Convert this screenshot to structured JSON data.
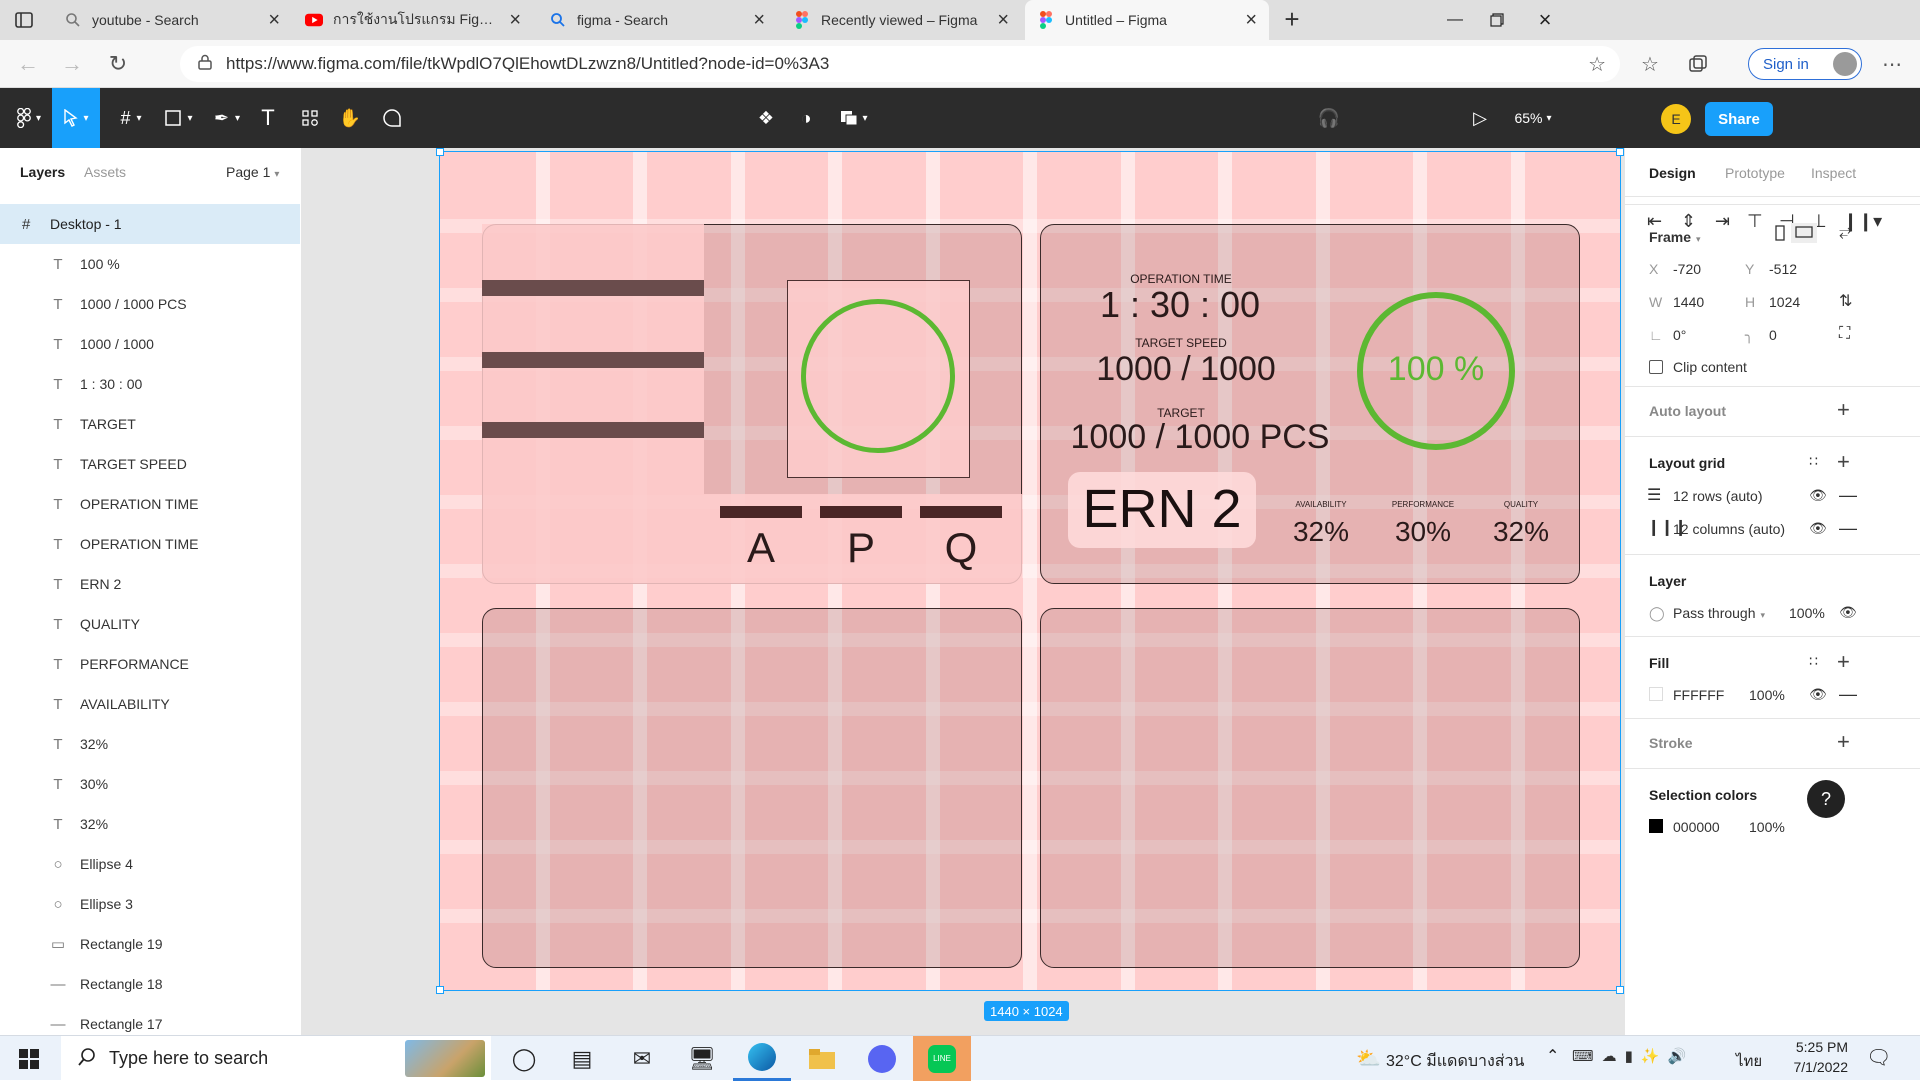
{
  "browser": {
    "tabs": [
      {
        "title": "youtube - Search"
      },
      {
        "title": "การใช้งานโปรแกรม Figma เบื้องต้น"
      },
      {
        "title": "figma - Search"
      },
      {
        "title": "Recently viewed – Figma"
      },
      {
        "title": "Untitled – Figma"
      }
    ],
    "url": "https://www.figma.com/file/tkWpdlO7QlEhowtDLzwzn8/Untitled?node-id=0%3A3",
    "signin_label": "Sign in"
  },
  "toolbar": {
    "share_label": "Share",
    "zoom": "65%",
    "avatar_initial": "E"
  },
  "left_panel": {
    "tabs": {
      "layers": "Layers",
      "assets": "Assets"
    },
    "page": "Page 1",
    "frame_layer": "Desktop - 1",
    "layers": [
      {
        "type": "text",
        "name": "100 %"
      },
      {
        "type": "text",
        "name": "1000 / 1000 PCS"
      },
      {
        "type": "text",
        "name": "1000 / 1000"
      },
      {
        "type": "text",
        "name": "1 : 30 : 00"
      },
      {
        "type": "text",
        "name": "TARGET"
      },
      {
        "type": "text",
        "name": "TARGET SPEED"
      },
      {
        "type": "text",
        "name": "OPERATION TIME"
      },
      {
        "type": "text",
        "name": "OPERATION TIME"
      },
      {
        "type": "text",
        "name": "ERN 2"
      },
      {
        "type": "text",
        "name": "QUALITY"
      },
      {
        "type": "text",
        "name": "PERFORMANCE"
      },
      {
        "type": "text",
        "name": "AVAILABILITY"
      },
      {
        "type": "text",
        "name": "32%"
      },
      {
        "type": "text",
        "name": "30%"
      },
      {
        "type": "text",
        "name": "32%"
      },
      {
        "type": "ellipse",
        "name": "Ellipse 4"
      },
      {
        "type": "ellipse",
        "name": "Ellipse 3"
      },
      {
        "type": "rect",
        "name": "Rectangle 19"
      },
      {
        "type": "line",
        "name": "Rectangle 18"
      },
      {
        "type": "line",
        "name": "Rectangle 17"
      }
    ]
  },
  "canvas": {
    "frame_size": "1440 × 1024",
    "labels": {
      "a": "A",
      "p": "P",
      "q": "Q"
    },
    "operation_time_label": "OPERATION TIME",
    "operation_time": "1 : 30 : 00",
    "target_speed_label": "TARGET SPEED",
    "target_speed": "1000 / 1000",
    "target_label": "TARGET",
    "target": "1000 / 1000 PCS",
    "percent": "100 %",
    "ern": "ERN 2",
    "availability_label": "AVAILABILITY",
    "availability": "32%",
    "performance_label": "PERFORMANCE",
    "performance": "30%",
    "quality_label": "QUALITY",
    "quality": "32%"
  },
  "right_panel": {
    "tabs": {
      "design": "Design",
      "prototype": "Prototype",
      "inspect": "Inspect"
    },
    "frame_label": "Frame",
    "x_label": "X",
    "x": "-720",
    "y_label": "Y",
    "y": "-512",
    "w_label": "W",
    "w": "1440",
    "h_label": "H",
    "h": "1024",
    "rotation": "0°",
    "radius": "0",
    "clip_content": "Clip content",
    "auto_layout": "Auto layout",
    "layout_grid": "Layout grid",
    "grid_rows": "12 rows (auto)",
    "grid_cols": "12 columns (auto)",
    "layer": "Layer",
    "blend": "Pass through",
    "layer_opacity": "100%",
    "fill": "Fill",
    "fill_hex": "FFFFFF",
    "fill_opacity": "100%",
    "stroke": "Stroke",
    "selection_colors": "Selection colors",
    "sel_hex": "000000",
    "sel_opacity": "100%",
    "help": "?"
  },
  "taskbar": {
    "search_placeholder": "Type here to search",
    "weather": "32°C มีแดดบางส่วน",
    "lang": "ไทย",
    "time": "5:25 PM",
    "date": "7/1/2022"
  },
  "colors": {
    "accent": "#18a0fb",
    "frame_fill": "#ffcdcd",
    "ring_green": "#5cb832",
    "toolbar_dark": "#2c2c2c"
  }
}
